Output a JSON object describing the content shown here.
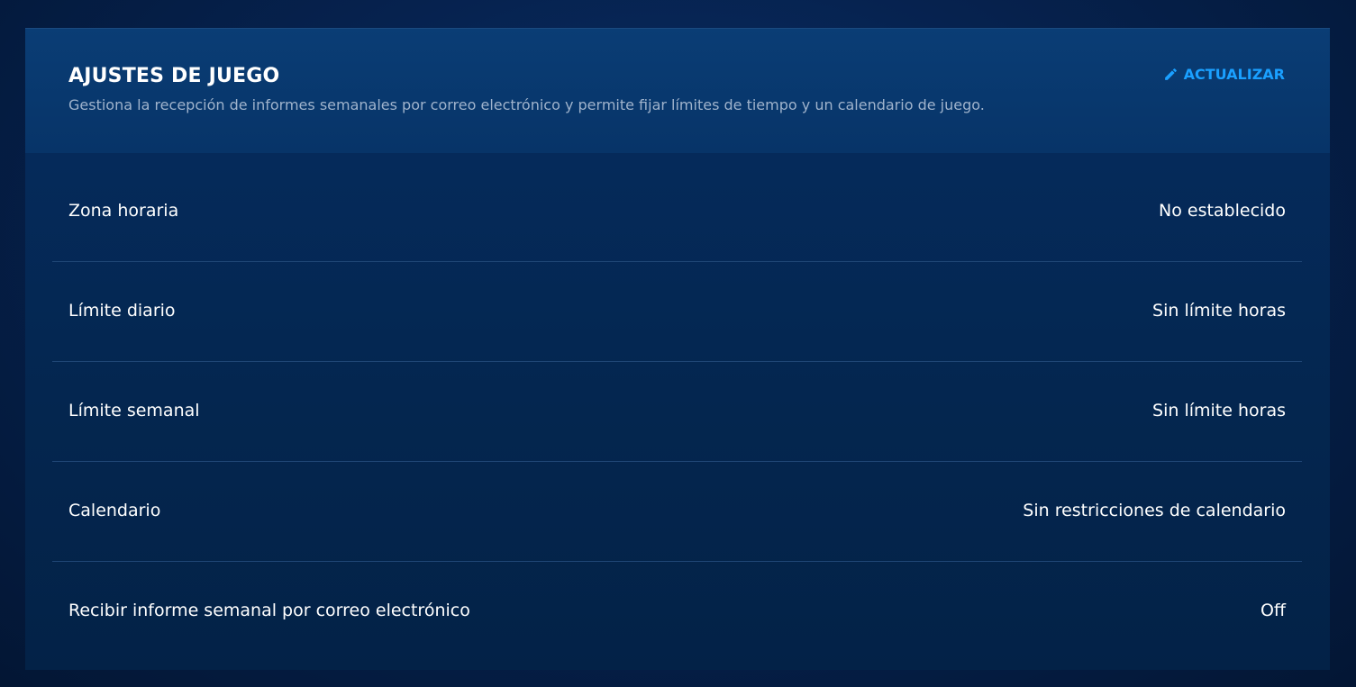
{
  "header": {
    "title": "AJUSTES DE JUEGO",
    "subtitle": "Gestiona la recepción de informes semanales por correo electrónico y permite fijar límites de tiempo y un calendario de juego.",
    "update_label": "ACTUALIZAR",
    "update_icon": "pencil-icon"
  },
  "colors": {
    "accent": "#1aa0ff",
    "subtitle": "#9fb3cc",
    "divider": "#1f4675"
  },
  "settings": [
    {
      "label": "Zona horaria",
      "value": "No establecido"
    },
    {
      "label": "Límite diario",
      "value": "Sin límite horas"
    },
    {
      "label": "Límite semanal",
      "value": "Sin límite horas"
    },
    {
      "label": "Calendario",
      "value": "Sin restricciones de calendario"
    },
    {
      "label": "Recibir informe semanal por correo electrónico",
      "value": "Off"
    }
  ]
}
